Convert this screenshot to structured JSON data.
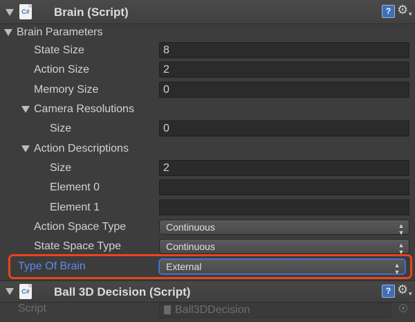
{
  "brain_component": {
    "title": "Brain (Script)",
    "script_icon_text": "C#",
    "help_icon": "?",
    "gear_icon": "⚙",
    "gear_caret": "▾"
  },
  "brain_parameters": {
    "section_label": "Brain Parameters",
    "state_size": {
      "label": "State Size",
      "value": "8"
    },
    "action_size": {
      "label": "Action Size",
      "value": "2"
    },
    "memory_size": {
      "label": "Memory Size",
      "value": "0"
    },
    "camera_resolutions": {
      "label": "Camera Resolutions",
      "size": {
        "label": "Size",
        "value": "0"
      }
    },
    "action_descriptions": {
      "label": "Action Descriptions",
      "size": {
        "label": "Size",
        "value": "2"
      },
      "element_0": {
        "label": "Element 0",
        "value": ""
      },
      "element_1": {
        "label": "Element 1",
        "value": ""
      }
    },
    "action_space_type": {
      "label": "Action Space Type",
      "value": "Continuous"
    },
    "state_space_type": {
      "label": "State Space Type",
      "value": "Continuous"
    }
  },
  "type_of_brain": {
    "label": "Type Of Brain",
    "value": "External"
  },
  "decision_component": {
    "title": "Ball 3D Decision (Script)",
    "script_icon_text": "C#",
    "help_icon": "?",
    "gear_icon": "⚙",
    "gear_caret": "▾",
    "script": {
      "label": "Script",
      "value": "Ball3DDecision"
    }
  },
  "select_arrows": "▲▼",
  "colors": {
    "background": "#3d3d3d",
    "highlight_border": "#e8461b",
    "highlight_label": "#5b8bf0",
    "field_bg": "#2b2b2b"
  }
}
